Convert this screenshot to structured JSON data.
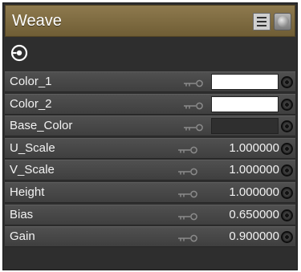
{
  "panel": {
    "title": "Weave",
    "header_icons": [
      "list-icon",
      "sphere-preview-icon"
    ],
    "output_icon": "output-connector-icon"
  },
  "colors": {
    "title_bar": "#7f6c44",
    "panel_bg": "#2e2e2e",
    "row_bg": "#484848",
    "text": "#f2f2f2"
  },
  "properties": [
    {
      "label": "Color_1",
      "type": "color",
      "color": "#ffffff"
    },
    {
      "label": "Color_2",
      "type": "color",
      "color": "#ffffff"
    },
    {
      "label": "Base_Color",
      "type": "color",
      "color": "#2f2f2f"
    },
    {
      "label": "U_Scale",
      "type": "number",
      "value": "1.000000"
    },
    {
      "label": "V_Scale",
      "type": "number",
      "value": "1.000000"
    },
    {
      "label": "Height",
      "type": "number",
      "value": "1.000000"
    },
    {
      "label": "Bias",
      "type": "number",
      "value": "0.650000"
    },
    {
      "label": "Gain",
      "type": "number",
      "value": "0.900000"
    }
  ]
}
